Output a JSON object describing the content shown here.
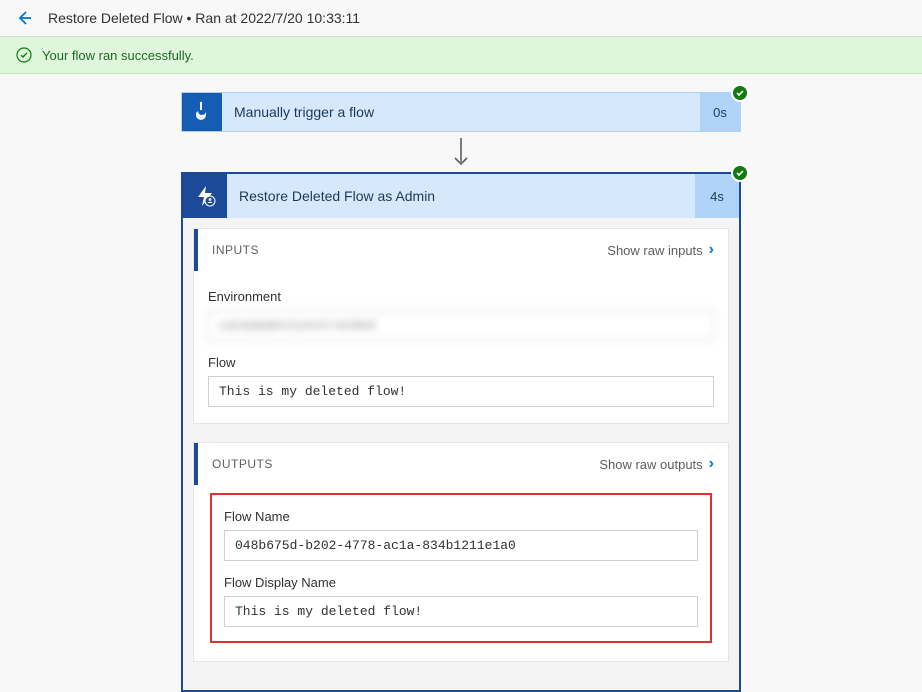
{
  "header": {
    "title": "Restore Deleted Flow  •  Ran at 2022/7/20 10:33:11"
  },
  "banner": {
    "message": "Your flow ran successfully."
  },
  "trigger": {
    "title": "Manually trigger a flow",
    "duration": "0s"
  },
  "action": {
    "title": "Restore Deleted Flow as Admin",
    "duration": "4s",
    "inputs": {
      "heading": "INPUTS",
      "show_raw": "Show raw inputs",
      "fields": {
        "environment": {
          "label": "Environment",
          "value": "canadadev1unstranded"
        },
        "flow": {
          "label": "Flow",
          "value": "This is my deleted flow!"
        }
      }
    },
    "outputs": {
      "heading": "OUTPUTS",
      "show_raw": "Show raw outputs",
      "fields": {
        "flow_name": {
          "label": "Flow Name",
          "value": "048b675d-b202-4778-ac1a-834b1211e1a0"
        },
        "flow_display_name": {
          "label": "Flow Display Name",
          "value": "This is my deleted flow!"
        }
      }
    }
  }
}
